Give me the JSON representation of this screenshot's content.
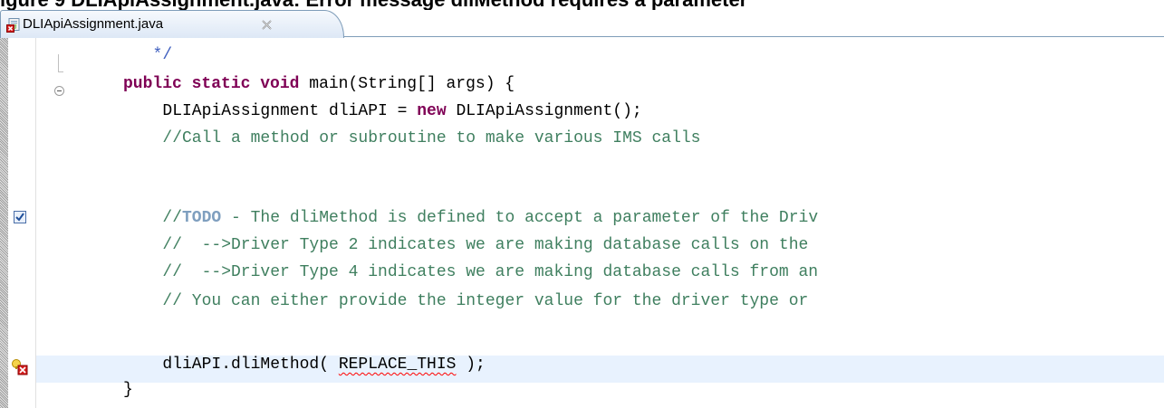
{
  "caption": "igure 9   DLIApiAssignment.java: Error message dliMethod requires a parameter",
  "tab": {
    "title": "DLIApiAssignment.java",
    "close_glyph": "✕"
  },
  "code_lines": [
    {
      "indent": "   ",
      "segments": [
        {
          "t": "*/",
          "c": "jd"
        }
      ]
    },
    {
      "indent": "",
      "segments": [
        {
          "t": "public",
          "c": "kw"
        },
        {
          "t": " "
        },
        {
          "t": "static",
          "c": "kw"
        },
        {
          "t": " "
        },
        {
          "t": "void",
          "c": "kw"
        },
        {
          "t": " main(String[] args) {"
        }
      ]
    },
    {
      "indent": "    ",
      "segments": [
        {
          "t": "DLIApiAssignment dliAPI = "
        },
        {
          "t": "new",
          "c": "kw"
        },
        {
          "t": " DLIApiAssignment();"
        }
      ]
    },
    {
      "indent": "    ",
      "segments": [
        {
          "t": "//Call a method or subroutine to make various IMS calls",
          "c": "cm"
        }
      ]
    },
    {
      "indent": "",
      "segments": []
    },
    {
      "indent": "    ",
      "segments": [
        {
          "t": "//",
          "c": "cm"
        },
        {
          "t": "TODO",
          "c": "todo"
        },
        {
          "t": " - The dliMethod is defined to accept a parameter of the Driv",
          "c": "cm"
        }
      ]
    },
    {
      "indent": "    ",
      "segments": [
        {
          "t": "//  -->Driver Type 2 indicates we are making database calls on the",
          "c": "cm"
        }
      ]
    },
    {
      "indent": "    ",
      "segments": [
        {
          "t": "//  -->Driver Type 4 indicates we are making database calls from an",
          "c": "cm"
        }
      ]
    },
    {
      "indent": "    ",
      "segments": [
        {
          "t": "// You can either provide the integer value for the driver type or",
          "c": "cm"
        }
      ]
    },
    {
      "indent": "    ",
      "segments": [
        {
          "t": "dliAPI.dliMethod( "
        },
        {
          "t": "REPLACE_THIS",
          "c": "err"
        },
        {
          "t": " );"
        }
      ]
    },
    {
      "indent": "",
      "segments": [
        {
          "t": "}"
        }
      ]
    }
  ],
  "colors": {
    "keyword": "#7f0055",
    "comment": "#3f7f5f",
    "javadoc": "#3f5fbf",
    "todo": "#7f9fbf",
    "current_line": "#e8f2fe",
    "error_underline": "#ff0000"
  },
  "icons": {
    "tab_file": "java-file-error-icon",
    "tab_close": "close-icon",
    "task_marker": "task-checkbox-icon",
    "error_marker": "quickfix-error-icon",
    "fold": "collapse-icon"
  }
}
